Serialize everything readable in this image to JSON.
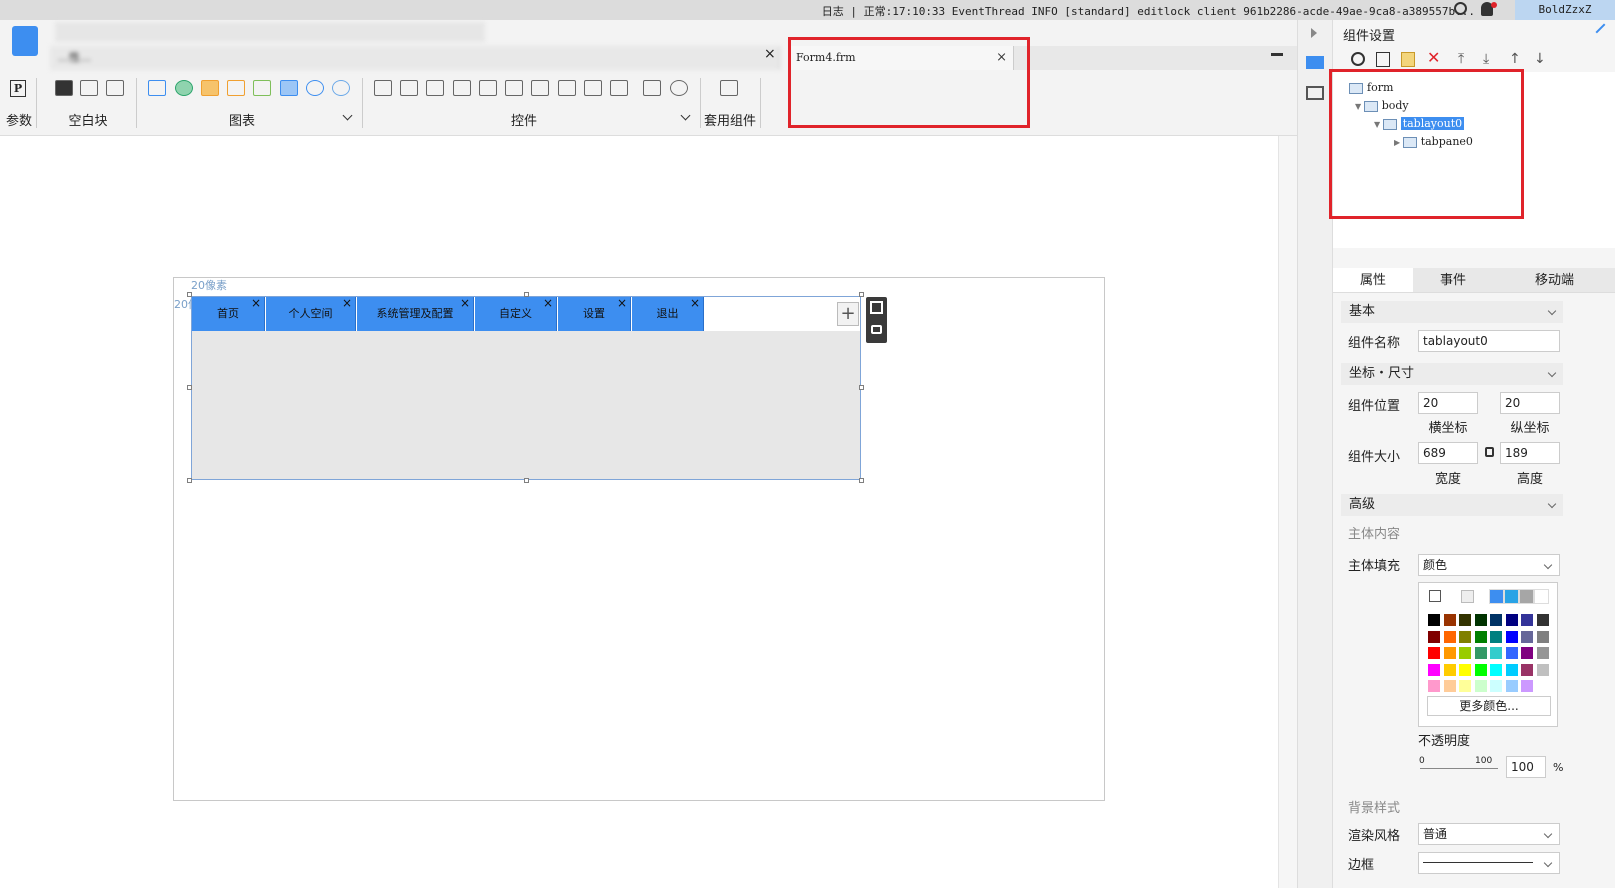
{
  "status": {
    "log_label": "日志",
    "text": "正常:17:10:33 EventThread INFO [standard] editlock client 961b2286-acde-49ae-9ca8-a389557b...",
    "user": "BoldZzxZ"
  },
  "tabs": {
    "blurred_tab_text": "…性…",
    "active_tab_title": "Form4.frm",
    "close_glyph": "×"
  },
  "toolbar": {
    "groups": [
      "参数",
      "空白块",
      "图表",
      "控件",
      "套用组件"
    ],
    "param_icon_text": "P"
  },
  "canvas": {
    "ruler_top": "20像素",
    "ruler_left": "20像素",
    "tab_items": [
      {
        "label": "首页"
      },
      {
        "label": "个人空间"
      },
      {
        "label": "系统管理及配置"
      },
      {
        "label": "自定义"
      },
      {
        "label": "设置"
      },
      {
        "label": "退出"
      }
    ],
    "add_tab_glyph": "+"
  },
  "panel": {
    "title": "组件设置",
    "tree": [
      {
        "label": "form"
      },
      {
        "label": "body"
      },
      {
        "label": "tablayout0"
      },
      {
        "label": "tabpane0"
      }
    ],
    "prop_tabs": [
      "属性",
      "事件",
      "移动端"
    ],
    "sections": {
      "basic": "基本",
      "coords": "坐标・尺寸",
      "advanced": "高级",
      "main_content": "主体内容",
      "bg_style": "背景样式"
    },
    "fields": {
      "name_label": "组件名称",
      "name_value": "tablayout0",
      "pos_label": "组件位置",
      "pos_x": "20",
      "pos_y": "20",
      "pos_x_caption": "横坐标",
      "pos_y_caption": "纵坐标",
      "size_label": "组件大小",
      "width": "689",
      "height": "189",
      "width_caption": "宽度",
      "height_caption": "高度",
      "fill_label": "主体填充",
      "fill_value": "颜色",
      "more_colors": "更多颜色...",
      "opacity_label": "不透明度",
      "opacity_min": "0",
      "opacity_max": "100",
      "opacity_value": "100",
      "opacity_unit": "%",
      "render_label": "渲染风格",
      "render_value": "普通",
      "border_label": "边框"
    },
    "palette": [
      [
        "#000000",
        "#993300",
        "#333300",
        "#003300",
        "#003366",
        "#000080",
        "#333399",
        "#333333"
      ],
      [
        "#800000",
        "#ff6600",
        "#808000",
        "#008000",
        "#008080",
        "#0000ff",
        "#666699",
        "#808080"
      ],
      [
        "#ff0000",
        "#ff9900",
        "#99cc00",
        "#339966",
        "#33cccc",
        "#3366ff",
        "#800080",
        "#969696"
      ],
      [
        "#ff00ff",
        "#ffcc00",
        "#ffff00",
        "#00ff00",
        "#00ffff",
        "#00ccff",
        "#993366",
        "#c0c0c0"
      ],
      [
        "#ff99cc",
        "#ffcc99",
        "#ffff99",
        "#ccffcc",
        "#ccffff",
        "#99ccff",
        "#cc99ff",
        "#ffffff"
      ]
    ],
    "recent_colors": [
      "#3d8ef0",
      "#29a3e6",
      "#a6a6a6",
      "#ffffff"
    ]
  }
}
